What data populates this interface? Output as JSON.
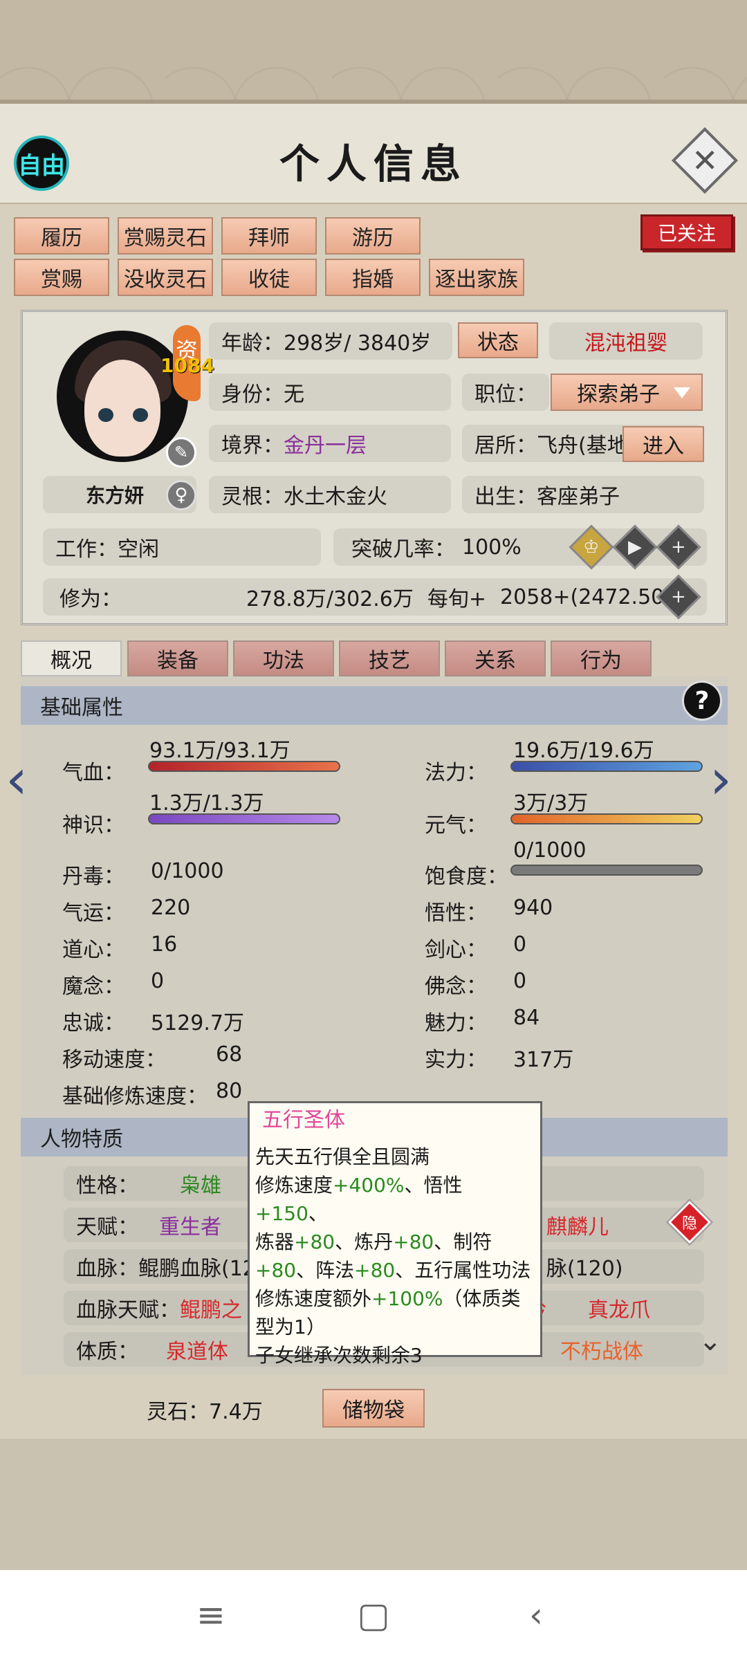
{
  "header": {
    "title": "个人信息",
    "mode_label": "自由",
    "close_icon": "close-icon"
  },
  "actions_row1": [
    "履历",
    "赏赐灵石",
    "拜师",
    "游历"
  ],
  "actions_row2": [
    "赏赐",
    "没收灵石",
    "收徒",
    "指婚",
    "逐出家族"
  ],
  "follow_label": "已关注",
  "character": {
    "name": "东方妍",
    "zi_label": "资",
    "zi_value": "1084",
    "age_label": "年龄：",
    "age_value": "298岁/ 3840岁",
    "state_button": "状态",
    "state_value": "混沌祖婴",
    "identity_label": "身份：",
    "identity_value": "无",
    "position_label": "职位：",
    "position_value": "探索弟子",
    "realm_label": "境界：",
    "realm_value": "金丹一层",
    "residence_label": "居所：",
    "residence_value": "飞舟(基地",
    "enter_button": "进入",
    "root_label": "灵根：",
    "root_value": "水土木金火",
    "birth_label": "出生：",
    "birth_value": "客座弟子",
    "work_label": "工作：",
    "work_value": "空闲",
    "breakthrough_label": "突破几率：",
    "breakthrough_value": "100%",
    "cultivation_label": "修为：",
    "cultivation_value": "278.8万/302.6万",
    "per_turn_label": "每旬+",
    "per_turn_value": "2058+(2472.50%)"
  },
  "tabs": [
    "概况",
    "装备",
    "功法",
    "技艺",
    "关系",
    "行为"
  ],
  "basic": {
    "section_title": "基础属性",
    "qixue_label": "气血：",
    "qixue_value": "93.1万/93.1万",
    "fali_label": "法力：",
    "fali_value": "19.6万/19.6万",
    "shenshi_label": "神识：",
    "shenshi_value": "1.3万/1.3万",
    "yuanqi_label": "元气：",
    "yuanqi_value": "3万/3万",
    "baoshi_label": "饱食度：",
    "baoshi_value": "0/1000",
    "bar_fill": {
      "qixue": 1.0,
      "fali": 1.0,
      "shenshi": 1.0,
      "yuanqi": 1.0,
      "baoshi": 0.0
    },
    "stats_left": [
      {
        "label": "丹毒：",
        "value": "0/1000"
      },
      {
        "label": "气运：",
        "value": "220"
      },
      {
        "label": "道心：",
        "value": "16"
      },
      {
        "label": "魔念：",
        "value": "0"
      },
      {
        "label": "忠诚：",
        "value": "5129.7万"
      },
      {
        "label": "移动速度：",
        "value": "68"
      },
      {
        "label": "基础修炼速度：",
        "value": "80"
      }
    ],
    "stats_right": [
      {
        "label": "悟性：",
        "value": "940"
      },
      {
        "label": "剑心：",
        "value": "0"
      },
      {
        "label": "佛念：",
        "value": "0"
      },
      {
        "label": "魅力：",
        "value": "84"
      },
      {
        "label": "实力：",
        "value": "317万"
      }
    ]
  },
  "traits": {
    "section_title": "人物特质",
    "personality_label": "性格：",
    "personality_value": "枭雄",
    "talent_label": "天赋：",
    "talent_value1": "重生者",
    "talent_value2": "麒麟儿",
    "yin_label": "隐",
    "blood_label": "血脉：",
    "blood_value1": "鲲鹏血脉(12",
    "blood_value2": "脉(120)",
    "blood_talent_label": "血脉天赋：",
    "blood_talent_value1": "鲲鹏之",
    "blood_talent_value2": "龙吟",
    "blood_talent_value3": "真龙爪",
    "physique_label": "体质：",
    "physique_value1": "泉道体",
    "physique_value2": "不朽战体"
  },
  "tooltip": {
    "title": "五行圣体",
    "line1": "先天五行俱全且圆满",
    "line2a": "修炼速度",
    "line2b": "+400%",
    "line2c": "、悟性",
    "line2d": "+150",
    "line2e": "、",
    "line3a": "炼器",
    "line3b": "+80",
    "line3c": "、炼丹",
    "line3d": "+80",
    "line3e": "、制符",
    "line4a": "+80",
    "line4b": "、阵法",
    "line4c": "+80",
    "line4d": "、五行属性功法",
    "line5a": "修炼速度额外",
    "line5b": "+100%",
    "line5c": "（体质类",
    "line6": "型为1）",
    "line7": "子女继承次数剩余3"
  },
  "footer": {
    "lingshi_label": "灵石：",
    "lingshi_value": "7.4万",
    "storage_button": "储物袋"
  },
  "colors": {
    "accent_button": "#e8a98b",
    "follow_red": "#c9262b",
    "realm_purple": "#8a2f9c"
  }
}
